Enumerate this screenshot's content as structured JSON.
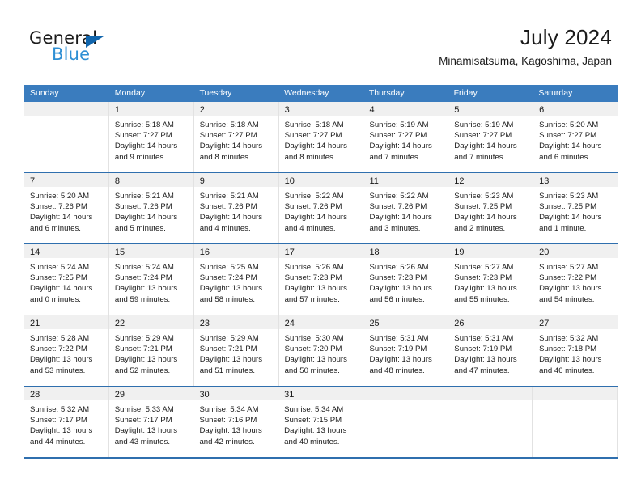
{
  "brand": {
    "word1": "General",
    "word2": "Blue",
    "triangle_color": "#1065ad",
    "blue_color": "#2e8fd4"
  },
  "header": {
    "title": "July 2024",
    "subtitle": "Minamisatsuma, Kagoshima, Japan"
  },
  "theme": {
    "header_bar": "#3a7cbe",
    "week_rule": "#2f6fae",
    "day_band": "#f0f0f0",
    "cell_border": "#e2e2e2"
  },
  "weekdays": [
    "Sunday",
    "Monday",
    "Tuesday",
    "Wednesday",
    "Thursday",
    "Friday",
    "Saturday"
  ],
  "weeks": [
    [
      {
        "empty": true,
        "day": "",
        "lines": [
          "",
          "",
          "",
          ""
        ]
      },
      {
        "empty": false,
        "day": "1",
        "lines": [
          "Sunrise: 5:18 AM",
          "Sunset: 7:27 PM",
          "Daylight: 14 hours",
          "and 9 minutes."
        ]
      },
      {
        "empty": false,
        "day": "2",
        "lines": [
          "Sunrise: 5:18 AM",
          "Sunset: 7:27 PM",
          "Daylight: 14 hours",
          "and 8 minutes."
        ]
      },
      {
        "empty": false,
        "day": "3",
        "lines": [
          "Sunrise: 5:18 AM",
          "Sunset: 7:27 PM",
          "Daylight: 14 hours",
          "and 8 minutes."
        ]
      },
      {
        "empty": false,
        "day": "4",
        "lines": [
          "Sunrise: 5:19 AM",
          "Sunset: 7:27 PM",
          "Daylight: 14 hours",
          "and 7 minutes."
        ]
      },
      {
        "empty": false,
        "day": "5",
        "lines": [
          "Sunrise: 5:19 AM",
          "Sunset: 7:27 PM",
          "Daylight: 14 hours",
          "and 7 minutes."
        ]
      },
      {
        "empty": false,
        "day": "6",
        "lines": [
          "Sunrise: 5:20 AM",
          "Sunset: 7:27 PM",
          "Daylight: 14 hours",
          "and 6 minutes."
        ]
      }
    ],
    [
      {
        "empty": false,
        "day": "7",
        "lines": [
          "Sunrise: 5:20 AM",
          "Sunset: 7:26 PM",
          "Daylight: 14 hours",
          "and 6 minutes."
        ]
      },
      {
        "empty": false,
        "day": "8",
        "lines": [
          "Sunrise: 5:21 AM",
          "Sunset: 7:26 PM",
          "Daylight: 14 hours",
          "and 5 minutes."
        ]
      },
      {
        "empty": false,
        "day": "9",
        "lines": [
          "Sunrise: 5:21 AM",
          "Sunset: 7:26 PM",
          "Daylight: 14 hours",
          "and 4 minutes."
        ]
      },
      {
        "empty": false,
        "day": "10",
        "lines": [
          "Sunrise: 5:22 AM",
          "Sunset: 7:26 PM",
          "Daylight: 14 hours",
          "and 4 minutes."
        ]
      },
      {
        "empty": false,
        "day": "11",
        "lines": [
          "Sunrise: 5:22 AM",
          "Sunset: 7:26 PM",
          "Daylight: 14 hours",
          "and 3 minutes."
        ]
      },
      {
        "empty": false,
        "day": "12",
        "lines": [
          "Sunrise: 5:23 AM",
          "Sunset: 7:25 PM",
          "Daylight: 14 hours",
          "and 2 minutes."
        ]
      },
      {
        "empty": false,
        "day": "13",
        "lines": [
          "Sunrise: 5:23 AM",
          "Sunset: 7:25 PM",
          "Daylight: 14 hours",
          "and 1 minute."
        ]
      }
    ],
    [
      {
        "empty": false,
        "day": "14",
        "lines": [
          "Sunrise: 5:24 AM",
          "Sunset: 7:25 PM",
          "Daylight: 14 hours",
          "and 0 minutes."
        ]
      },
      {
        "empty": false,
        "day": "15",
        "lines": [
          "Sunrise: 5:24 AM",
          "Sunset: 7:24 PM",
          "Daylight: 13 hours",
          "and 59 minutes."
        ]
      },
      {
        "empty": false,
        "day": "16",
        "lines": [
          "Sunrise: 5:25 AM",
          "Sunset: 7:24 PM",
          "Daylight: 13 hours",
          "and 58 minutes."
        ]
      },
      {
        "empty": false,
        "day": "17",
        "lines": [
          "Sunrise: 5:26 AM",
          "Sunset: 7:23 PM",
          "Daylight: 13 hours",
          "and 57 minutes."
        ]
      },
      {
        "empty": false,
        "day": "18",
        "lines": [
          "Sunrise: 5:26 AM",
          "Sunset: 7:23 PM",
          "Daylight: 13 hours",
          "and 56 minutes."
        ]
      },
      {
        "empty": false,
        "day": "19",
        "lines": [
          "Sunrise: 5:27 AM",
          "Sunset: 7:23 PM",
          "Daylight: 13 hours",
          "and 55 minutes."
        ]
      },
      {
        "empty": false,
        "day": "20",
        "lines": [
          "Sunrise: 5:27 AM",
          "Sunset: 7:22 PM",
          "Daylight: 13 hours",
          "and 54 minutes."
        ]
      }
    ],
    [
      {
        "empty": false,
        "day": "21",
        "lines": [
          "Sunrise: 5:28 AM",
          "Sunset: 7:22 PM",
          "Daylight: 13 hours",
          "and 53 minutes."
        ]
      },
      {
        "empty": false,
        "day": "22",
        "lines": [
          "Sunrise: 5:29 AM",
          "Sunset: 7:21 PM",
          "Daylight: 13 hours",
          "and 52 minutes."
        ]
      },
      {
        "empty": false,
        "day": "23",
        "lines": [
          "Sunrise: 5:29 AM",
          "Sunset: 7:21 PM",
          "Daylight: 13 hours",
          "and 51 minutes."
        ]
      },
      {
        "empty": false,
        "day": "24",
        "lines": [
          "Sunrise: 5:30 AM",
          "Sunset: 7:20 PM",
          "Daylight: 13 hours",
          "and 50 minutes."
        ]
      },
      {
        "empty": false,
        "day": "25",
        "lines": [
          "Sunrise: 5:31 AM",
          "Sunset: 7:19 PM",
          "Daylight: 13 hours",
          "and 48 minutes."
        ]
      },
      {
        "empty": false,
        "day": "26",
        "lines": [
          "Sunrise: 5:31 AM",
          "Sunset: 7:19 PM",
          "Daylight: 13 hours",
          "and 47 minutes."
        ]
      },
      {
        "empty": false,
        "day": "27",
        "lines": [
          "Sunrise: 5:32 AM",
          "Sunset: 7:18 PM",
          "Daylight: 13 hours",
          "and 46 minutes."
        ]
      }
    ],
    [
      {
        "empty": false,
        "day": "28",
        "lines": [
          "Sunrise: 5:32 AM",
          "Sunset: 7:17 PM",
          "Daylight: 13 hours",
          "and 44 minutes."
        ]
      },
      {
        "empty": false,
        "day": "29",
        "lines": [
          "Sunrise: 5:33 AM",
          "Sunset: 7:17 PM",
          "Daylight: 13 hours",
          "and 43 minutes."
        ]
      },
      {
        "empty": false,
        "day": "30",
        "lines": [
          "Sunrise: 5:34 AM",
          "Sunset: 7:16 PM",
          "Daylight: 13 hours",
          "and 42 minutes."
        ]
      },
      {
        "empty": false,
        "day": "31",
        "lines": [
          "Sunrise: 5:34 AM",
          "Sunset: 7:15 PM",
          "Daylight: 13 hours",
          "and 40 minutes."
        ]
      },
      {
        "empty": true,
        "day": "",
        "lines": [
          "",
          "",
          "",
          ""
        ]
      },
      {
        "empty": true,
        "day": "",
        "lines": [
          "",
          "",
          "",
          ""
        ]
      },
      {
        "empty": true,
        "day": "",
        "lines": [
          "",
          "",
          "",
          ""
        ]
      }
    ]
  ]
}
